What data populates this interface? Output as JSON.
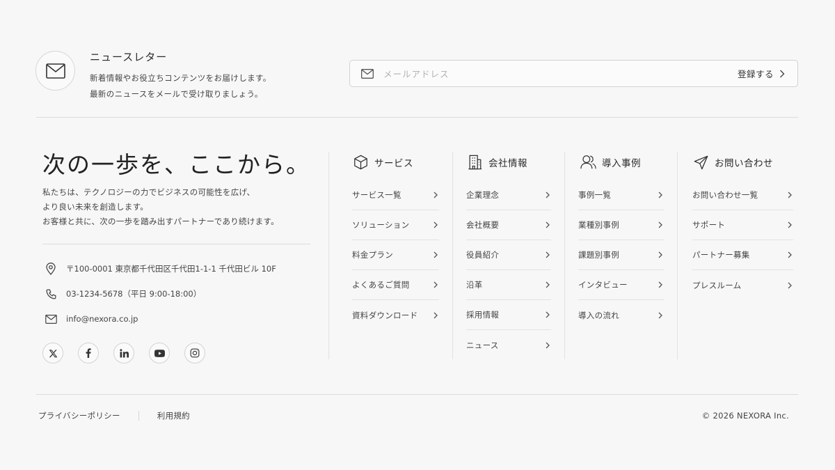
{
  "newsletter": {
    "title": "ニュースレター",
    "description_line1": "新着情報やお役立ちコンテンツをお届けします。",
    "description_line2": "最新のニュースをメールで受け取りましょう。",
    "email_placeholder": "メールアドレス",
    "email_value": "",
    "submit_label": "登録する"
  },
  "brand": {
    "headline": "次の一歩を、ここから。",
    "intro_lines": [
      "私たちは、テクノロジーの力でビジネスの可能性を広げ、",
      "より良い未来を創造します。",
      "お客様と共に、次の一歩を踏み出すパートナーであり続けます。"
    ],
    "address": "〒100-0001 東京都千代田区千代田1-1-1 千代田ビル 10F",
    "phone": "03-1234-5678（平日 9:00-18:00）",
    "email": "info@nexora.co.jp",
    "socials": [
      "x-icon",
      "facebook-icon",
      "linkedin-icon",
      "youtube-icon",
      "instagram-icon"
    ]
  },
  "nav": {
    "services": {
      "title": "サービス",
      "icon": "cube-icon",
      "items": [
        "サービス一覧",
        "ソリューション",
        "料金プラン",
        "よくあるご質問",
        "資料ダウンロード"
      ]
    },
    "company": {
      "title": "会社情報",
      "icon": "building-icon",
      "items": [
        "企業理念",
        "会社概要",
        "役員紹介",
        "沿革",
        "採用情報",
        "ニュース"
      ]
    },
    "cases": {
      "title": "導入事例",
      "icon": "user-icon",
      "items": [
        "事例一覧",
        "業種別事例",
        "課題別事例",
        "インタビュー",
        "導入の流れ"
      ]
    },
    "contact": {
      "title": "お問い合わせ",
      "icon": "paper-plane-icon",
      "items": [
        "お問い合わせ一覧",
        "サポート",
        "パートナー募集",
        "プレスルーム"
      ]
    }
  },
  "footer": {
    "privacy_label": "プライバシーポリシー",
    "terms_label": "利用規約",
    "copyright": "© 2026 NEXORA Inc."
  },
  "colors": {
    "background": "#f7f7f7",
    "text": "#333333",
    "border": "#dcdcdc"
  }
}
